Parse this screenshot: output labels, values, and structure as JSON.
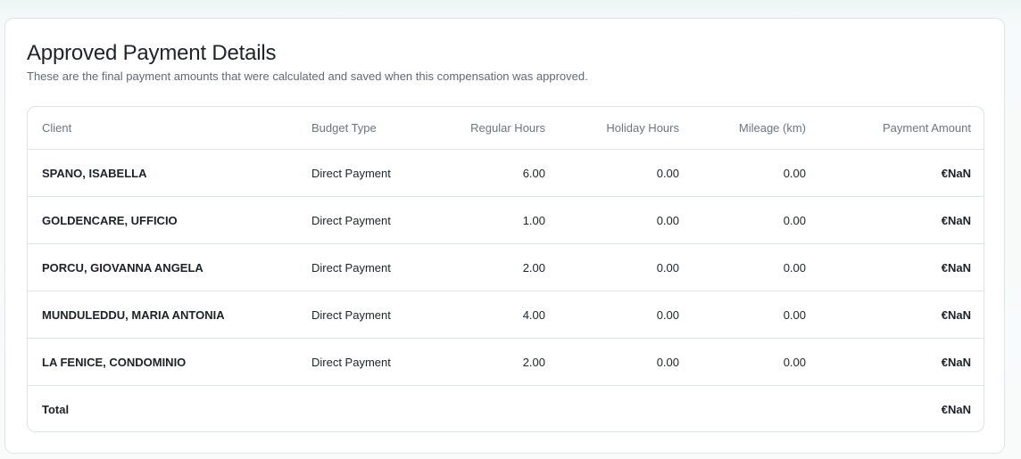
{
  "section": {
    "title": "Approved Payment Details",
    "subtitle": "These are the final payment amounts that were calculated and saved when this compensation was approved."
  },
  "table": {
    "headers": {
      "client": "Client",
      "budget_type": "Budget Type",
      "regular_hours": "Regular Hours",
      "holiday_hours": "Holiday Hours",
      "mileage": "Mileage (km)",
      "payment_amount": "Payment Amount"
    },
    "rows": [
      {
        "client": "SPANO, ISABELLA",
        "budget_type": "Direct Payment",
        "regular_hours": "6.00",
        "holiday_hours": "0.00",
        "mileage": "0.00",
        "payment_amount": "€NaN"
      },
      {
        "client": "GOLDENCARE, UFFICIO",
        "budget_type": "Direct Payment",
        "regular_hours": "1.00",
        "holiday_hours": "0.00",
        "mileage": "0.00",
        "payment_amount": "€NaN"
      },
      {
        "client": "PORCU, GIOVANNA ANGELA",
        "budget_type": "Direct Payment",
        "regular_hours": "2.00",
        "holiday_hours": "0.00",
        "mileage": "0.00",
        "payment_amount": "€NaN"
      },
      {
        "client": "MUNDULEDDU, MARIA ANTONIA",
        "budget_type": "Direct Payment",
        "regular_hours": "4.00",
        "holiday_hours": "0.00",
        "mileage": "0.00",
        "payment_amount": "€NaN"
      },
      {
        "client": "LA FENICE, CONDOMINIO",
        "budget_type": "Direct Payment",
        "regular_hours": "2.00",
        "holiday_hours": "0.00",
        "mileage": "0.00",
        "payment_amount": "€NaN"
      }
    ],
    "total": {
      "label": "Total",
      "payment_amount": "€NaN"
    }
  }
}
